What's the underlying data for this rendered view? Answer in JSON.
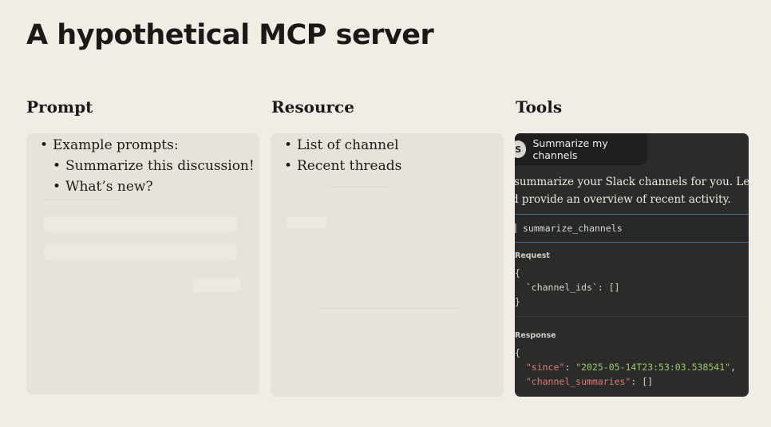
{
  "slide": {
    "title": "A hypothetical MCP server"
  },
  "columns": {
    "prompt": {
      "heading": "Prompt",
      "bullet": "Example prompts:",
      "sub_bullets": [
        "Summarize this discussion!",
        "What’s new?"
      ]
    },
    "resource": {
      "heading": "Resource",
      "bullets": [
        "List of channel",
        "Recent threads"
      ]
    },
    "tools": {
      "heading": "Tools",
      "user_avatar_letter": "S",
      "user_message": "Summarize my channels",
      "assistant_line_1": "summarize your Slack channels for you. Let me che",
      "assistant_line_2": "d provide an overview of recent activity.",
      "tool_name": "summarize_channels",
      "request_label": "Request",
      "request_open": "{",
      "request_key": "`channel_ids`",
      "request_value": ": []",
      "request_close": "}",
      "response_label": "Response",
      "response_open": "{",
      "since_key": "\"since\"",
      "since_value": "\"2025-05-14T23:53:03.538541\"",
      "summaries_key": "\"channel_summaries\"",
      "summaries_value": ": []"
    }
  },
  "colors": {
    "background": "#f1ede6",
    "light_panel": "#e7e3dc",
    "dark_panel": "#2b2b2a",
    "tool_border": "#3f6b93",
    "json_key": "#e07a74",
    "json_string": "#9cc66f"
  }
}
